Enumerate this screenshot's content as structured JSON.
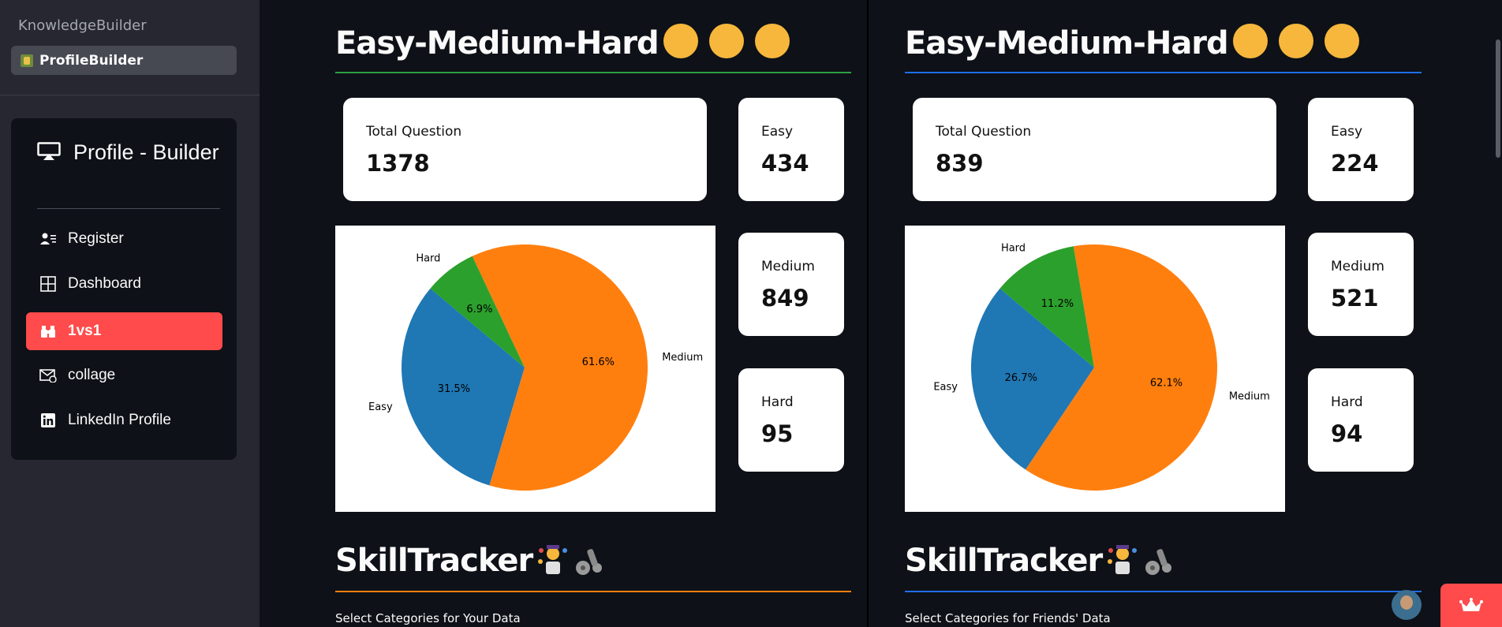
{
  "sidebar": {
    "app_title": "KnowledgeBuilder",
    "current_page": "ProfileBuilder",
    "menu_title": "Profile - Builder",
    "items": [
      {
        "label": "Register",
        "icon": "person-lines-icon"
      },
      {
        "label": "Dashboard",
        "icon": "grid-icon"
      },
      {
        "label": "1vs1",
        "icon": "binoculars-icon",
        "active": true
      },
      {
        "label": "collage",
        "icon": "envelope-icon"
      },
      {
        "label": "LinkedIn Profile",
        "icon": "linkedin-icon"
      }
    ]
  },
  "left": {
    "heading": "Easy-Medium-Hard",
    "rule_color": "#2ea043",
    "total_label": "Total Question",
    "total_value": "1378",
    "easy_label": "Easy",
    "easy_value": "434",
    "medium_label": "Medium",
    "medium_value": "849",
    "hard_label": "Hard",
    "hard_value": "95",
    "skill_heading": "SkillTracker",
    "skill_rule_color": "#ff7f0e",
    "select_label": "Select Categories for Your Data"
  },
  "right": {
    "heading": "Easy-Medium-Hard",
    "rule_color": "#1f6feb",
    "total_label": "Total Question",
    "total_value": "839",
    "easy_label": "Easy",
    "easy_value": "224",
    "medium_label": "Medium",
    "medium_value": "521",
    "hard_label": "Hard",
    "hard_value": "94",
    "skill_heading": "SkillTracker",
    "skill_rule_color": "#1f6feb",
    "select_label": "Select Categories for Friends' Data"
  },
  "chart_data": [
    {
      "type": "pie",
      "categories": [
        "Easy",
        "Medium",
        "Hard"
      ],
      "values": [
        31.5,
        61.6,
        6.9
      ],
      "labels": [
        "31.5%",
        "61.6%",
        "6.9%"
      ],
      "colors": [
        "#1f77b4",
        "#ff7f0e",
        "#2ca02c"
      ]
    },
    {
      "type": "pie",
      "categories": [
        "Easy",
        "Medium",
        "Hard"
      ],
      "values": [
        26.7,
        62.1,
        11.2
      ],
      "labels": [
        "26.7%",
        "62.1%",
        "11.2%"
      ],
      "colors": [
        "#1f77b4",
        "#ff7f0e",
        "#2ca02c"
      ]
    }
  ],
  "colors": {
    "background": "#0e1117",
    "sidebar": "#262730",
    "accent": "#ff4b4b"
  }
}
